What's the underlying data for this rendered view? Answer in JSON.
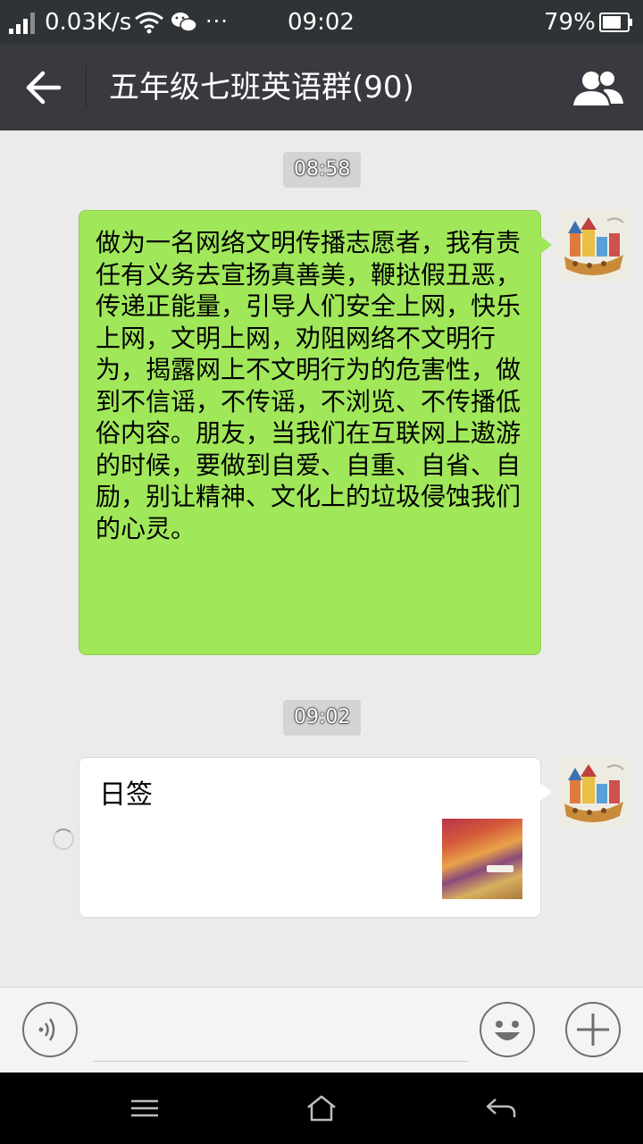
{
  "status_bar": {
    "net_speed": "0.03K/s",
    "time": "09:02",
    "battery_pct": "79%",
    "icons": [
      "signal-icon",
      "wifi-icon",
      "wechat-icon",
      "more-dots-icon",
      "battery-icon"
    ],
    "dots": "···"
  },
  "title_bar": {
    "title": "五年级七班英语群(90)",
    "back_icon": "back-arrow-icon",
    "group_icon": "group-members-icon"
  },
  "messages": [
    {
      "timestamp": "08:58",
      "type": "text",
      "text": "做为一名网络文明传播志愿者，我有责任有义务去宣扬真善美，鞭挞假丑恶，传递正能量，引导人们安全上网，快乐上网，文明上网，劝阻网络不文明行为，揭露网上不文明行为的危害性，做到不信谣，不传谣，不浏览、不传播低俗内容。朋友，当我们在互联网上遨游的时候，要做到自爱、自重、自省、自励，别让精神、文化上的垃圾侵蚀我们的心灵。"
    },
    {
      "timestamp": "09:02",
      "type": "link-card",
      "title": "日签",
      "status": "sending"
    }
  ],
  "input_bar": {
    "value": "",
    "placeholder": "",
    "icons": [
      "voice-icon",
      "emoji-icon",
      "plus-icon"
    ]
  },
  "nav_bar": {
    "icons": [
      "menu-icon",
      "home-icon",
      "back-icon"
    ]
  },
  "colors": {
    "status_bar_bg": "#2f3335",
    "title_bar_bg": "#393a3f",
    "chat_bg": "#ebebeb",
    "sent_bubble": "#a0e75a",
    "card_bubble": "#ffffff"
  }
}
